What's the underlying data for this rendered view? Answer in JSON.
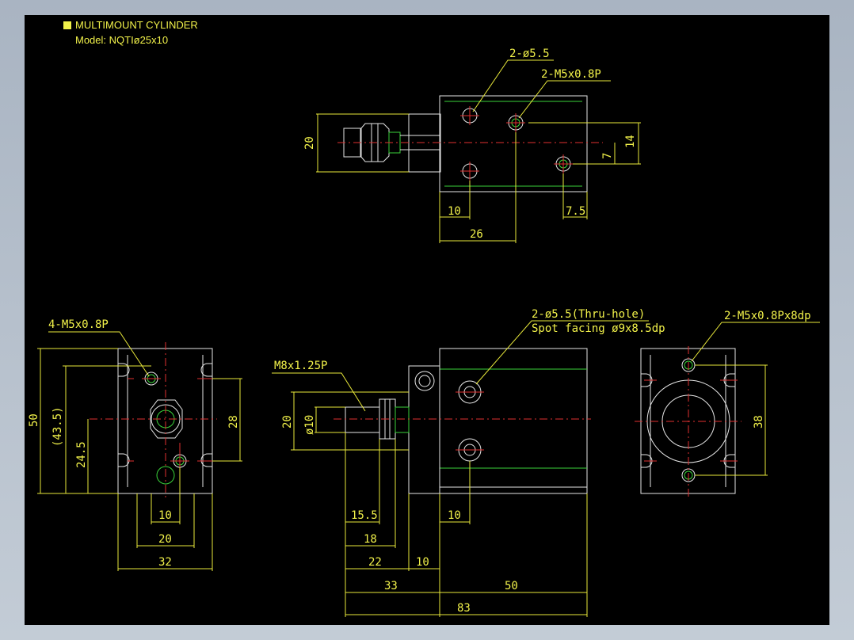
{
  "title": {
    "name": "MULTIMOUNT CYLINDER",
    "model": "Model: NQTIø25x10"
  },
  "colors": {
    "background": "#000000",
    "dimension": "#f2f24a",
    "outline": "#e6e6e6",
    "centerline": "#e03030",
    "hidden": "#3ad23a"
  },
  "top_view": {
    "callout_hole": "2-ø5.5",
    "callout_thread": "2-M5x0.8P",
    "dims": {
      "height": "20",
      "offset_14": "14",
      "offset_7": "7",
      "left_10": "10",
      "right_7_5": "7.5",
      "pos_26": "26"
    }
  },
  "left_view": {
    "callout": "4-M5x0.8P",
    "dims": {
      "h50": "50",
      "h43_5": "(43.5)",
      "h24_5": "24.5",
      "h28": "28",
      "w10": "10",
      "w20": "20",
      "w32": "32"
    }
  },
  "front_view": {
    "callout_rod": "M8x1.25P",
    "callout_hole_1": "2-ø5.5(Thru-hole)",
    "callout_hole_2": "Spot facing ø9x8.5dp",
    "dims": {
      "h20": "20",
      "d10": "ø10",
      "l15_5": "15.5",
      "l18": "18",
      "l22": "22",
      "l10_flange": "10",
      "l10_hole": "10",
      "l33": "33",
      "l50": "50",
      "l83": "83"
    }
  },
  "right_view": {
    "callout": "2-M5x0.8Px8dp",
    "dims": {
      "h38": "38"
    }
  }
}
